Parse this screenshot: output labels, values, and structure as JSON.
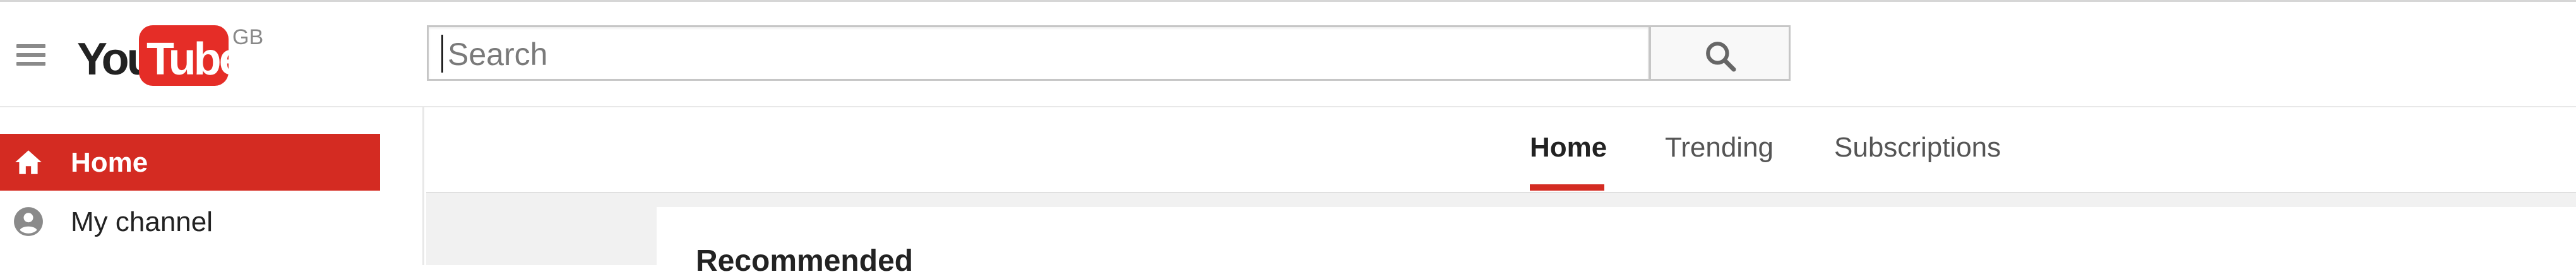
{
  "header": {
    "logo": {
      "you": "You",
      "tube": "Tube",
      "region": "GB"
    },
    "search": {
      "placeholder": "Search"
    }
  },
  "sidebar": {
    "items": [
      {
        "label": "Home",
        "icon": "home-icon",
        "active": true
      },
      {
        "label": "My channel",
        "icon": "account-icon",
        "active": false
      }
    ]
  },
  "tabs": [
    {
      "label": "Home",
      "active": true
    },
    {
      "label": "Trending",
      "active": false
    },
    {
      "label": "Subscriptions",
      "active": false
    }
  ],
  "main": {
    "section_title": "Recommended"
  },
  "colors": {
    "accent": "#d42b22",
    "logo_red": "#e52d27"
  }
}
